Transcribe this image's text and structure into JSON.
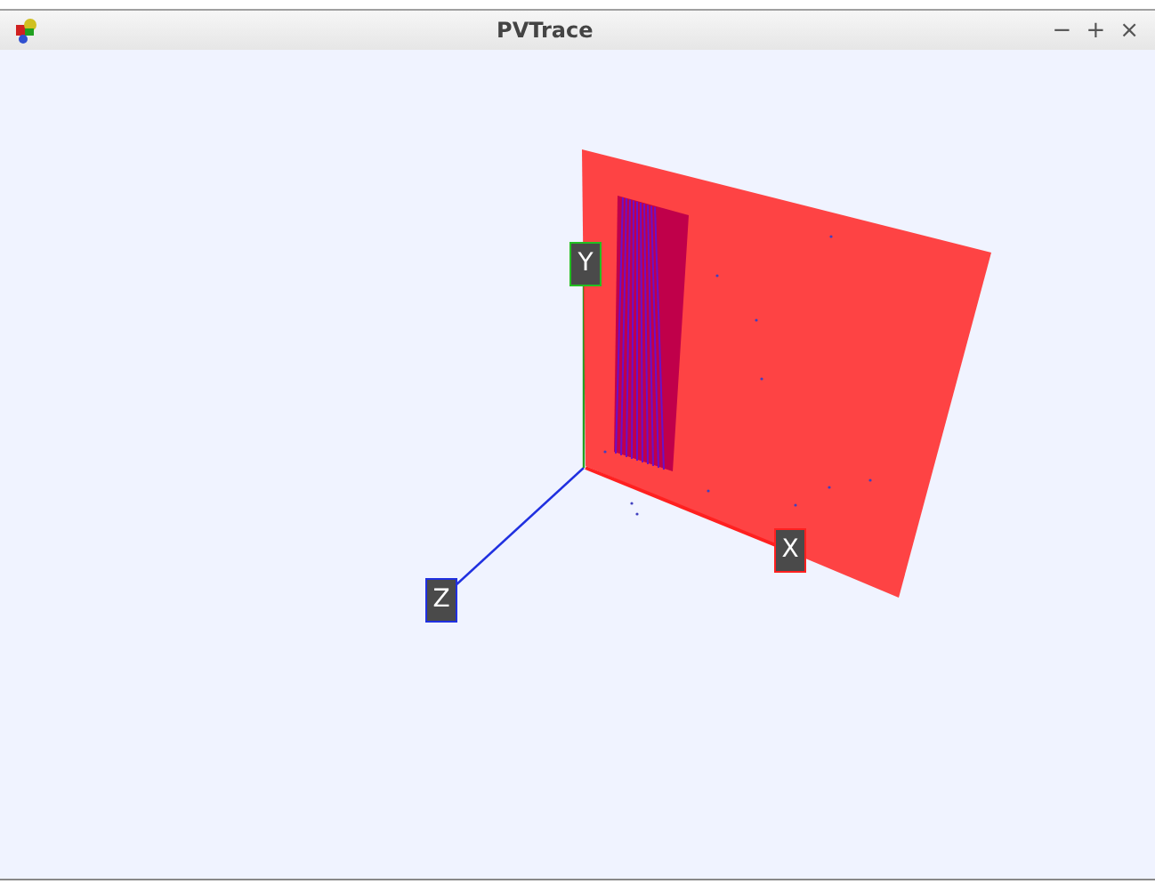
{
  "window": {
    "title": "PVTrace",
    "controls": [
      "−",
      "+",
      "×"
    ]
  },
  "axes": [
    {
      "label": "Y",
      "color": "#22c022"
    },
    {
      "label": "X",
      "color": "#ff2020"
    },
    {
      "label": "Z",
      "color": "#2030e0"
    }
  ]
}
